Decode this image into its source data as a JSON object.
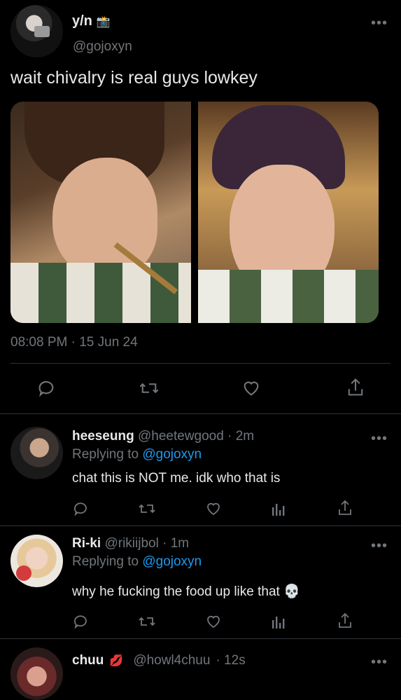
{
  "tweet": {
    "display_name": "y/n",
    "handle": "@gojoxyn",
    "text": "wait chivalry is real guys lowkey",
    "timestamp": "08:08 PM · 15 Jun 24",
    "badge_icon": "camera-emoji-icon"
  },
  "actions": [
    "reply-icon",
    "retweet-icon",
    "like-icon",
    "share-icon"
  ],
  "replies": [
    {
      "name": "heeseung",
      "handle": "@heetewgood",
      "time": "· 2m",
      "replying_prefix": "Replying to",
      "replying_to": "@gojoxyn",
      "text": "chat this is NOT me. idk who that is"
    },
    {
      "name": "Ri-ki",
      "handle": "@rikiijbol",
      "time": "· 1m",
      "replying_prefix": "Replying to",
      "replying_to": "@gojoxyn",
      "text": "why he fucking the food up like that",
      "emoji": "💀"
    },
    {
      "name": "chuu",
      "handle": "@howl4chuu",
      "time": "· 12s",
      "emoji": "💋"
    }
  ],
  "colors": {
    "background": "#000000",
    "text": "#e7e9ea",
    "muted": "#71767b",
    "accent": "#1d9bf0",
    "divider": "#2f3336"
  }
}
